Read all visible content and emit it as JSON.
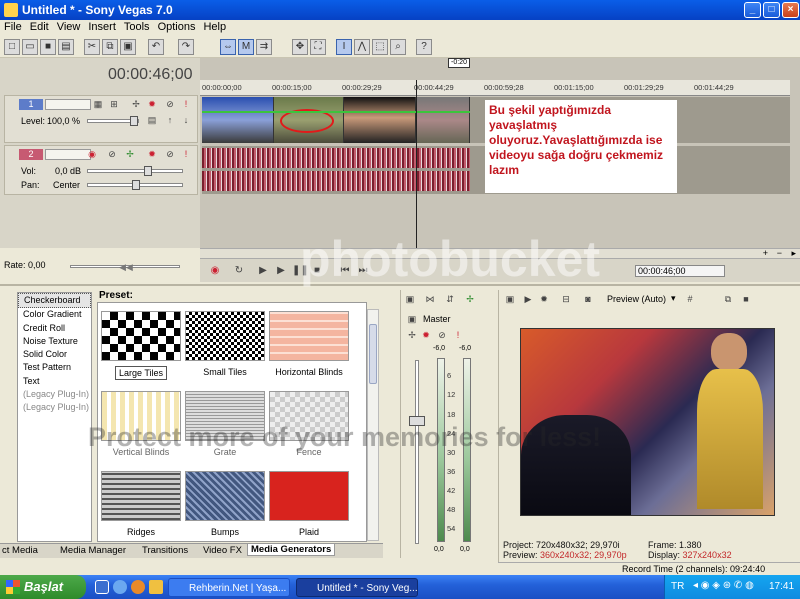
{
  "window": {
    "title": "Untitled * - Sony Vegas 7.0"
  },
  "menu": [
    "File",
    "Edit",
    "View",
    "Insert",
    "Tools",
    "Options",
    "Help"
  ],
  "timecode": "00:00:46;00",
  "ruler_marker": "-0:20",
  "ruler_ticks": [
    "00:00:00;00",
    "00:00:15;00",
    "00:00:29;29",
    "00:00:44;29",
    "00:00:59;28",
    "00:01:15;00",
    "00:01:29;29",
    "00:01:44;29"
  ],
  "video_track": {
    "number": "1",
    "level_label": "Level:",
    "level_value": "100,0 %"
  },
  "audio_track": {
    "number": "2",
    "vol_label": "Vol:",
    "vol_value": "0,0 dB",
    "pan_label": "Pan:",
    "pan_value": "Center"
  },
  "annotation": "Bu şekil yaptığımızda yavaşlatmış oluyoruz.Yavaşlattığımızda ise videoyu sağa doğru çekmemiz lazım",
  "rate": {
    "label": "Rate:",
    "value": "0,00"
  },
  "transport_timecode": "00:00:46;00",
  "generators": [
    "Checkerboard",
    "Color Gradient",
    "Credit Roll",
    "Noise Texture",
    "Solid Color",
    "Test Pattern",
    "Text",
    "(Legacy Plug-In) T",
    "(Legacy Plug-In) V"
  ],
  "preset_label": "Preset:",
  "presets": [
    "Large Tiles",
    "Small Tiles",
    "Horizontal Blinds",
    "Vertical Blinds",
    "Grate",
    "Fence",
    "Ridges",
    "Bumps",
    "Plaid"
  ],
  "tabs": [
    "ct Media",
    "Media Manager",
    "Transitions",
    "Video FX",
    "Media Generators"
  ],
  "mixer": {
    "label": "Master",
    "peak_left": "-6,0",
    "peak_right": "-6,0",
    "scale": [
      "6",
      "12",
      "18",
      "24",
      "30",
      "36",
      "42",
      "48",
      "54"
    ],
    "bottom_left": "0,0",
    "bottom_right": "0,0"
  },
  "preview": {
    "mode": "Preview (Auto)",
    "project_label": "Project:",
    "project_value": "720x480x32; 29,970i",
    "frame_label": "Frame:",
    "frame_value": "1.380",
    "preview_label": "Preview:",
    "preview_value": "360x240x32; 29,970p",
    "display_label": "Display:",
    "display_value": "327x240x32"
  },
  "record_time": "Record Time (2 channels): 09:24:40",
  "taskbar": {
    "start": "Başlat",
    "tasks": [
      "Rehberin.Net | Yaşa...",
      "Untitled * - Sony Veg..."
    ],
    "lang": "TR",
    "clock": "17:41"
  },
  "watermark": {
    "brand": "photobucket",
    "tagline": "Protect more of your memories for less!"
  },
  "colors": {
    "titlebar": "#0641c4",
    "annotation_text": "#c1151e",
    "taskbar": "#2461d9",
    "start": "#2e8b2a"
  }
}
